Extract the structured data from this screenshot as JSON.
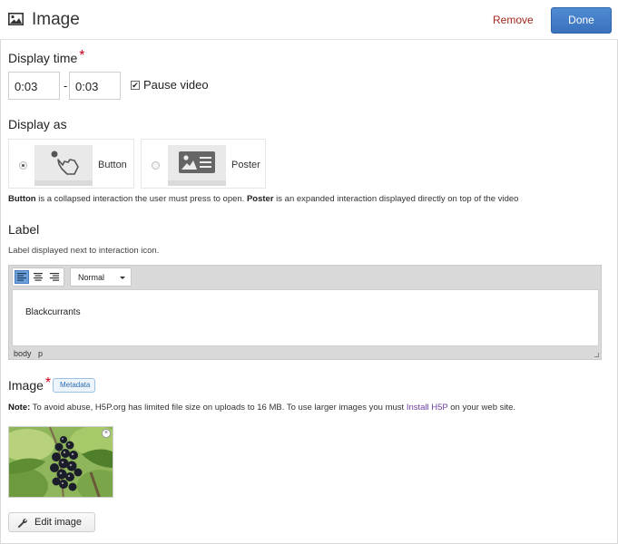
{
  "header": {
    "title": "Image",
    "icon": "image-icon",
    "remove_label": "Remove",
    "done_label": "Done",
    "remove_color": "#a3281c",
    "done_color": "#3a72bd"
  },
  "display_time": {
    "label": "Display time",
    "required_mark": "*",
    "start": "0:03",
    "separator": "-",
    "end": "0:03",
    "pause_video_label": "Pause video",
    "pause_video_checked": true,
    "check_mark": "✔"
  },
  "display_as": {
    "label": "Display as",
    "options": [
      {
        "label": "Button",
        "selected": true,
        "icon": "pointer-hand-icon"
      },
      {
        "label": "Poster",
        "selected": false,
        "icon": "poster-icon"
      }
    ],
    "description": {
      "button_word": "Button",
      "mid": " is a collapsed interaction the user must press to open. ",
      "poster_word": "Poster",
      "end": " is an expanded interaction displayed directly on top of the video"
    }
  },
  "label_section": {
    "label": "Label",
    "help": "Label displayed next to interaction icon.",
    "editor": {
      "align_buttons": [
        "align-left-icon",
        "align-center-icon",
        "align-right-icon"
      ],
      "active_align": "align-left-icon",
      "format_value": "Normal",
      "content": "Blackcurrants",
      "path": [
        "body",
        "p"
      ]
    }
  },
  "image_section": {
    "label": "Image",
    "required_mark": "*",
    "metadata_label": "Metadata",
    "note": {
      "prefix": "Note:",
      "text": " To avoid abuse, H5P.org has limited file size on uploads to 16 MB. To use larger images you must ",
      "link": "Install H5P",
      "suffix": " on your web site."
    },
    "close_glyph": "×",
    "edit_label": "Edit image"
  }
}
